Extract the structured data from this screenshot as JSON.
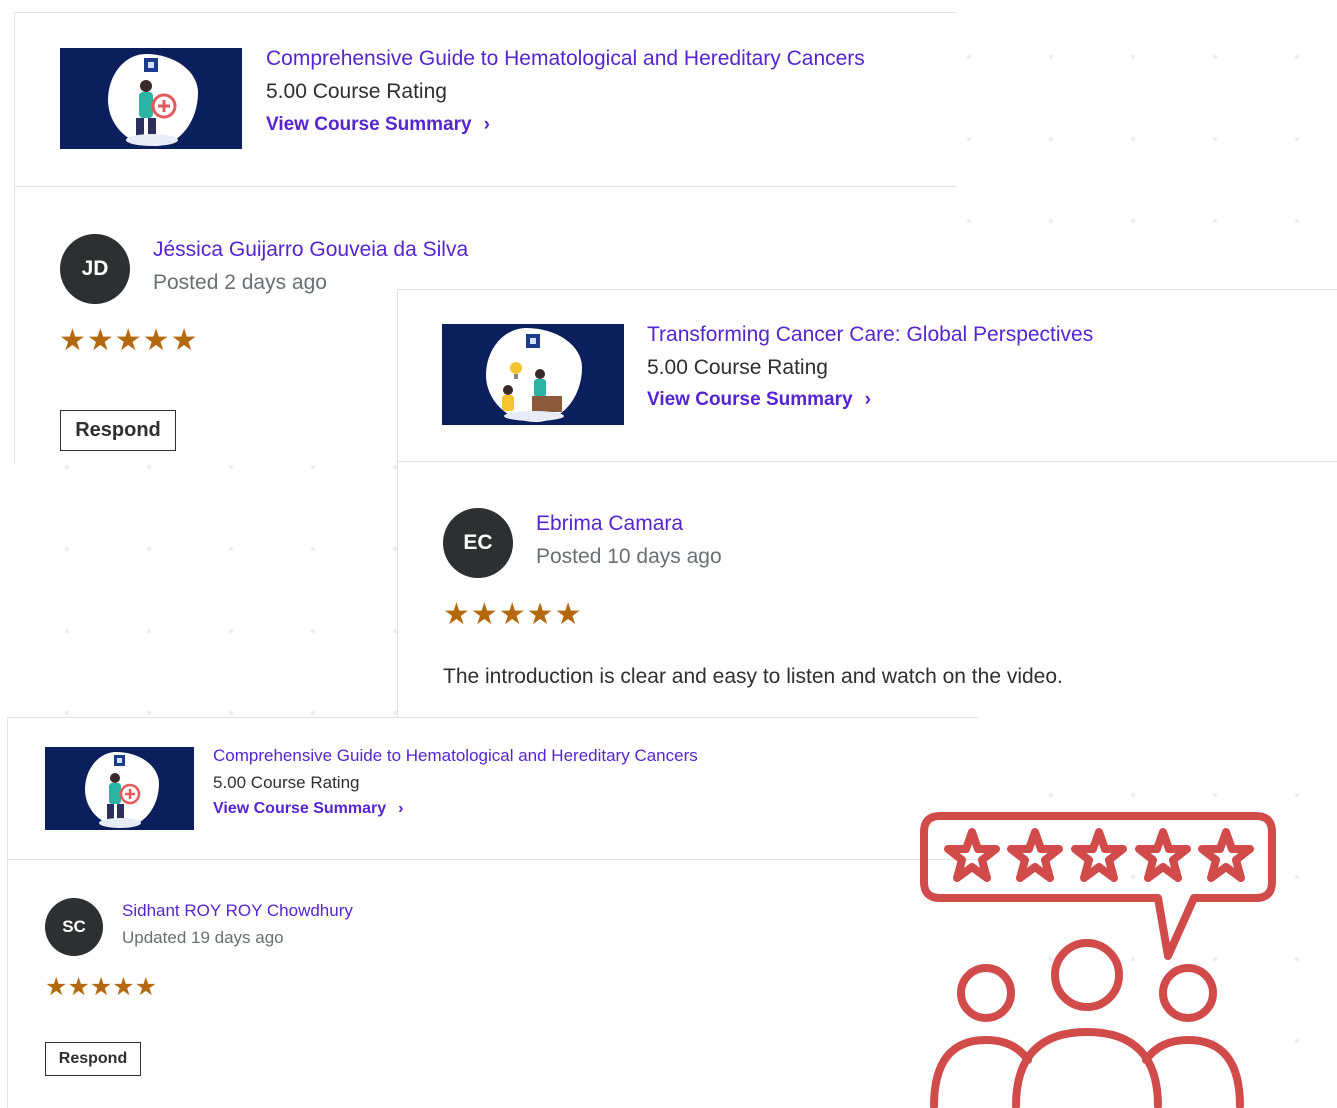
{
  "colors": {
    "link": "#5624d0",
    "text": "#2d2f31",
    "muted": "#6a6f73",
    "star": "#b4690e",
    "thumb_bg": "#0a1f5c",
    "illustration": "#d14b4b"
  },
  "card1": {
    "course_title": "Comprehensive Guide to Hematological and Hereditary Cancers",
    "course_rating": "5.00 Course Rating",
    "summary_link": "View Course Summary",
    "chevron": "›",
    "avatar_initials": "JD",
    "reviewer_name": "Jéssica Guijarro Gouveia da Silva",
    "posted": "Posted 2 days ago",
    "stars": "★★★★★",
    "respond_label": "Respond"
  },
  "card2": {
    "course_title": "Transforming Cancer Care: Global Perspectives",
    "course_rating": "5.00 Course Rating",
    "summary_link": "View Course Summary",
    "chevron": "›",
    "avatar_initials": "EC",
    "reviewer_name": "Ebrima Camara",
    "posted": "Posted 10 days ago",
    "stars": "★★★★★",
    "review_text": "The introduction is clear and easy to listen and watch on the video."
  },
  "card3": {
    "course_title": "Comprehensive Guide to Hematological and Hereditary Cancers",
    "course_rating": "5.00 Course Rating",
    "summary_link": "View Course Summary",
    "chevron": "›",
    "avatar_initials": "SC",
    "reviewer_name": "Sidhant ROY ROY Chowdhury",
    "posted": "Updated 19 days ago",
    "stars": "★★★★★",
    "respond_label": "Respond"
  },
  "illustration": {
    "icon": "group-review-five-stars-icon"
  }
}
